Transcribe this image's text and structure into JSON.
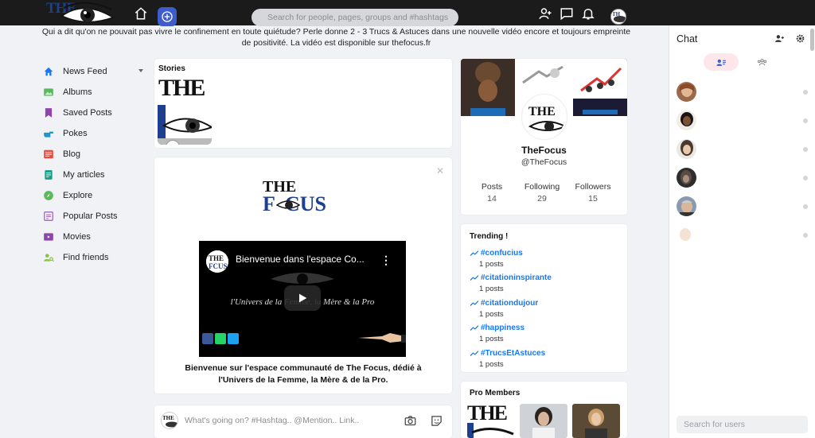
{
  "header": {
    "logo_text": "THE",
    "search_placeholder": "Search for people, pages, groups and #hashtags"
  },
  "announcement": "Qui a dit qu'on ne pouvait pas vivre le confinement en toute quiétude? Perle donne 2 - 3 Trucs & Astuces dans une nouvelle vidéo encore et toujours empreinte de positivité. La vidéo est disponible sur thefocus.fr",
  "sidebar": {
    "items": [
      {
        "label": "News Feed",
        "icon": "home-icon",
        "color": "#1877f2"
      },
      {
        "label": "Albums",
        "icon": "image-icon",
        "color": "#5cb85c"
      },
      {
        "label": "Saved Posts",
        "icon": "bookmark-icon",
        "color": "#8e44ad"
      },
      {
        "label": "Pokes",
        "icon": "hand-point-icon",
        "color": "#2196c9"
      },
      {
        "label": "Blog",
        "icon": "blog-icon",
        "color": "#e74c3c"
      },
      {
        "label": "My articles",
        "icon": "article-icon",
        "color": "#16a085"
      },
      {
        "label": "Explore",
        "icon": "compass-icon",
        "color": "#5cb85c"
      },
      {
        "label": "Popular Posts",
        "icon": "popular-icon",
        "color": "#9b59b6"
      },
      {
        "label": "Movies",
        "icon": "movie-icon",
        "color": "#8e44ad"
      },
      {
        "label": "Find friends",
        "icon": "find-friends-icon",
        "color": "#8bc34a"
      }
    ]
  },
  "stories": {
    "title": "Stories",
    "tile_text": "THE"
  },
  "post": {
    "logo_top": "THE",
    "logo_bottom": "F  CUS",
    "video_title": "Bienvenue dans l'espace Co...",
    "video_subtitle": "l'Univers de la Femme, la Mère & la Pro",
    "caption": "Bienvenue sur l'espace communauté de The Focus, dédié à l'Univers de la Femme, la Mère & de la Pro."
  },
  "composer": {
    "placeholder": "What's going on? #Hashtag.. @Mention.. Link.."
  },
  "profile": {
    "name": "TheFocus",
    "handle": "@TheFocus",
    "stats": [
      {
        "label": "Posts",
        "value": "14"
      },
      {
        "label": "Following",
        "value": "29"
      },
      {
        "label": "Followers",
        "value": "15"
      }
    ]
  },
  "trending": {
    "title": "Trending !",
    "items": [
      {
        "tag": "#confucius",
        "count": "1 posts"
      },
      {
        "tag": "#citationinspirante",
        "count": "1 posts"
      },
      {
        "tag": "#citationdujour",
        "count": "1 posts"
      },
      {
        "tag": "#happiness",
        "count": "1 posts"
      },
      {
        "tag": "#TrucsEtAstuces",
        "count": "1 posts"
      }
    ]
  },
  "pro_members": {
    "title": "Pro Members",
    "tile_text": "THE"
  },
  "chat": {
    "title": "Chat",
    "search_placeholder": "Search for users",
    "contacts": 6
  },
  "colors": {
    "topbar": "#1b1b1b",
    "accent": "#1877f2",
    "plus_button": "#3e5ccc"
  }
}
